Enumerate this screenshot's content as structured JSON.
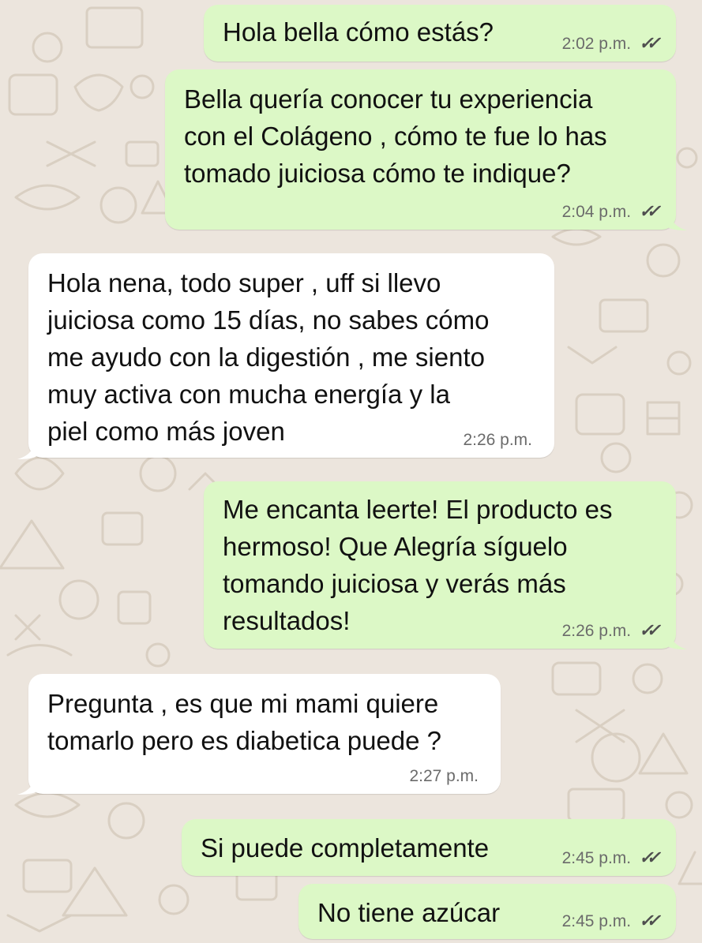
{
  "chat": {
    "colors": {
      "background": "#ECE5DD",
      "outgoing_bubble": "#DCF8C6",
      "incoming_bubble": "#FFFFFF",
      "timestamp": "#6b6b6b",
      "read_ticks": "#4f4f4f"
    },
    "messages": [
      {
        "direction": "outgoing",
        "text": "Hola bella cómo estás?",
        "time": "2:02 p.m.",
        "ticks": "✓✓",
        "status_icon": "double-check-icon"
      },
      {
        "direction": "outgoing",
        "text": "Bella quería conocer tu experiencia\ncon el Colágeno , cómo te fue lo has\ntomado juiciosa cómo te indique?",
        "time": "2:04 p.m.",
        "ticks": "✓✓",
        "status_icon": "double-check-icon"
      },
      {
        "direction": "incoming",
        "text": "Hola nena, todo super , uff si llevo\njuiciosa como 15 días, no sabes cómo\nme ayudo con la digestión , me siento\nmuy activa con mucha energía y la\npiel como más joven",
        "time": "2:26 p.m."
      },
      {
        "direction": "outgoing",
        "text": "Me encanta leerte! El producto es\nhermoso! Que Alegría síguelo\ntomando juiciosa y verás más\nresultados!",
        "time": "2:26 p.m.",
        "ticks": "✓✓",
        "status_icon": "double-check-icon"
      },
      {
        "direction": "incoming",
        "text": "Pregunta , es que mi mami quiere\ntomarlo pero es diabetica puede ?",
        "time": "2:27 p.m."
      },
      {
        "direction": "outgoing",
        "text": "Si puede completamente",
        "time": "2:45 p.m.",
        "ticks": "✓✓",
        "status_icon": "double-check-icon"
      },
      {
        "direction": "outgoing",
        "text": "No tiene azúcar",
        "time": "2:45 p.m.",
        "ticks": "✓✓",
        "status_icon": "double-check-icon"
      }
    ]
  }
}
